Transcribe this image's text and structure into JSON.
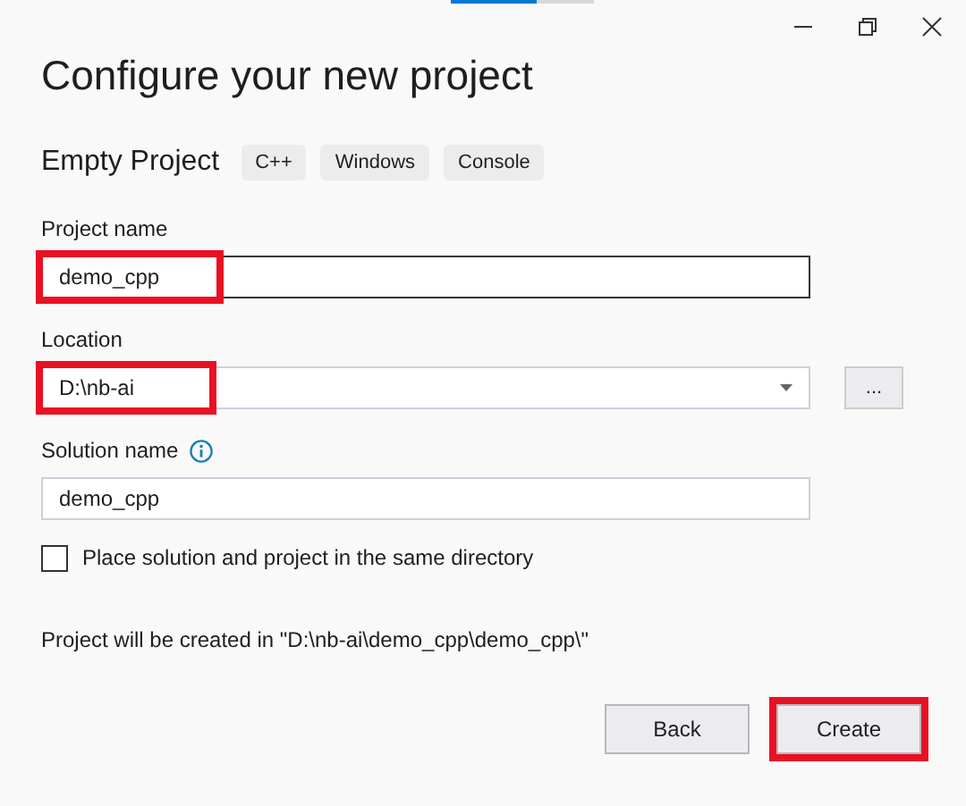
{
  "title": "Configure your new project",
  "template": {
    "name": "Empty Project",
    "tags": [
      "C++",
      "Windows",
      "Console"
    ]
  },
  "fields": [
    {
      "kind": "text",
      "label": "Project name",
      "value": "demo_cpp",
      "focused": true,
      "highlighted": true
    },
    {
      "kind": "dropdown",
      "label": "Location",
      "value": "D:\\nb-ai",
      "focused": false,
      "highlighted": true,
      "browse_label": "..."
    },
    {
      "kind": "text",
      "label": "Solution name",
      "value": "demo_cpp",
      "focused": false,
      "highlighted": false,
      "info": true
    }
  ],
  "same_directory": {
    "label": "Place solution and project in the same directory",
    "checked": false
  },
  "output_path": "Project will be created in \"D:\\nb-ai\\demo_cpp\\demo_cpp\\\"",
  "buttons": [
    {
      "label": "Back",
      "highlighted": false
    },
    {
      "label": "Create",
      "highlighted": true
    }
  ]
}
